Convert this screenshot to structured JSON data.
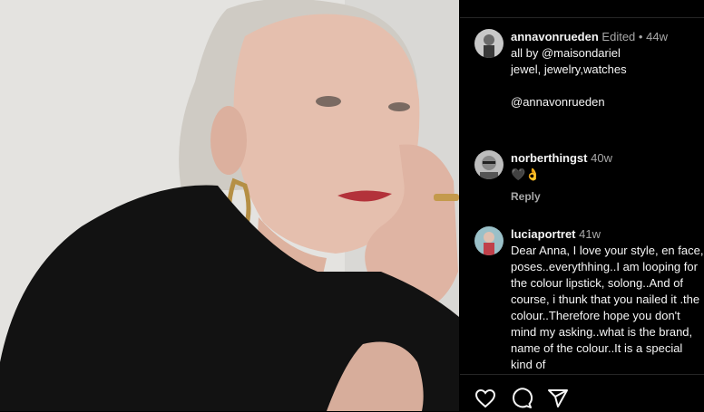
{
  "post": {
    "author": "annavonrueden",
    "edited_label": "Edited",
    "time": "44w",
    "caption_lines": [
      "all by @maisondariel",
      "jewel, jewelry,watches",
      "",
      "@annavonrueden"
    ]
  },
  "comments": [
    {
      "user": "norberthingst",
      "time": "40w",
      "text": "🖤👌",
      "reply_label": "Reply"
    },
    {
      "user": "luciaportret",
      "time": "41w",
      "text": "Dear Anna, I love your style, en face, poses..everythhing..I am looping for the colour lipstick, solong..And of course, i thunk that you nailed it .the colour..Therefore hope you don't mind my asking..what is the brand, name of the colour..It is a special kind of"
    }
  ],
  "actions": {
    "like_icon": "heart-icon",
    "comment_icon": "comment-icon",
    "share_icon": "share-icon"
  },
  "colors": {
    "background": "#000000",
    "text": "#f5f5f5",
    "secondary": "#a8a8a8"
  }
}
